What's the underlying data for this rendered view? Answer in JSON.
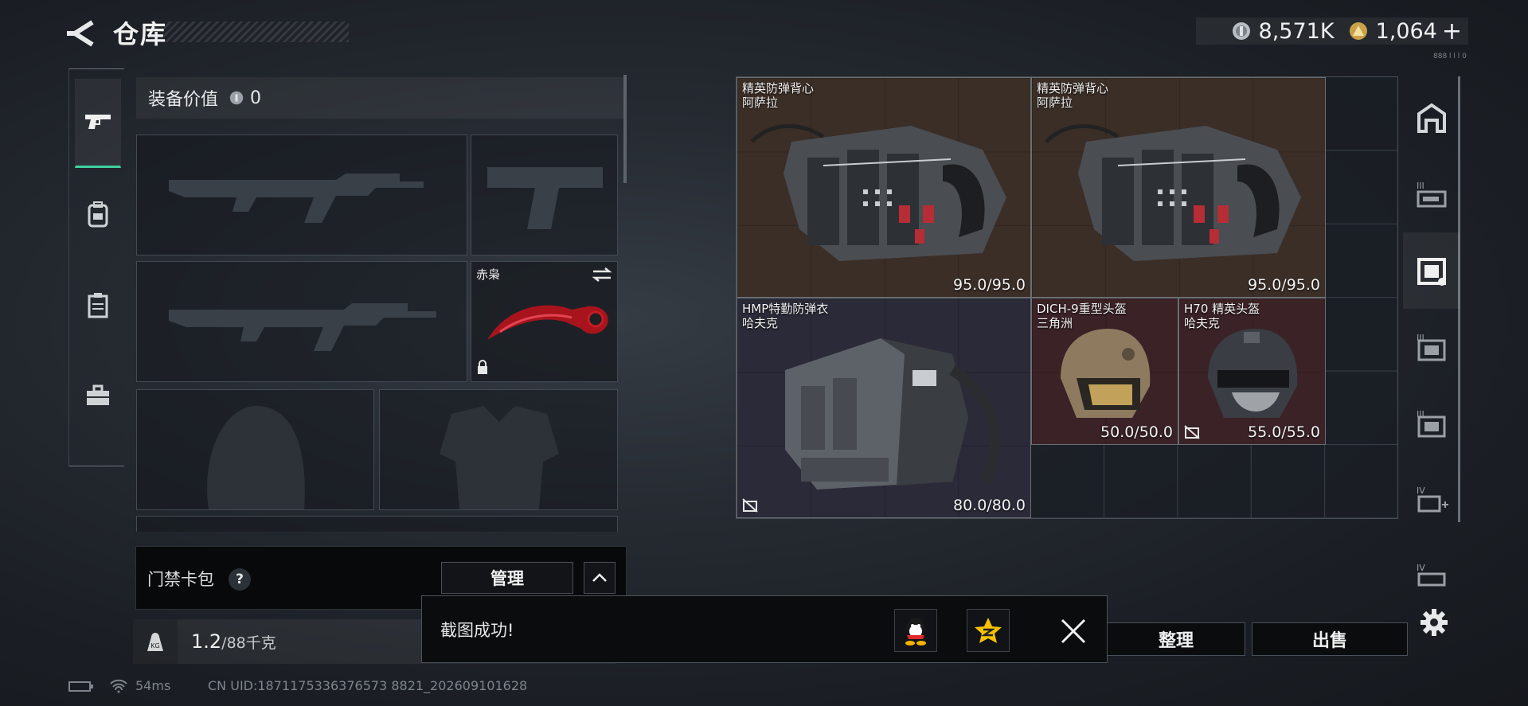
{
  "header": {
    "title": "仓库",
    "currency": [
      {
        "icon": "silver-coin-icon",
        "value": "8,571K"
      },
      {
        "icon": "gold-triangle-icon",
        "value": "1,064"
      }
    ],
    "add_label": "+"
  },
  "left_nav": {
    "items": [
      {
        "name": "weapons",
        "icon": "pistol-icon",
        "selected": true
      },
      {
        "name": "gear",
        "icon": "backpack-icon",
        "selected": false
      },
      {
        "name": "container",
        "icon": "case-icon",
        "selected": false
      },
      {
        "name": "toolbox",
        "icon": "briefcase-icon",
        "selected": false
      }
    ]
  },
  "loadout": {
    "value_label": "装备价值",
    "value_amount": "0",
    "knife_name": "赤枭",
    "card_pack_label": "门禁卡包",
    "help_label": "?",
    "manage_label": "管理",
    "weight_value": "1.2",
    "weight_capacity": "/88千克"
  },
  "stash": {
    "items": [
      {
        "line1": "精英防弹背心",
        "line2": "阿萨拉",
        "durability": "95.0/95.0",
        "kind": "vest"
      },
      {
        "line1": "精英防弹背心",
        "line2": "阿萨拉",
        "durability": "95.0/95.0",
        "kind": "vest"
      },
      {
        "line1": "HMP特勤防弹衣",
        "line2": "哈夫克",
        "durability": "80.0/80.0",
        "kind": "carrier"
      },
      {
        "line1": "DICH-9重型头盔",
        "line2": "三角洲",
        "durability": "50.0/50.0",
        "kind": "helmet-tan"
      },
      {
        "line1": "H70 精英头盔",
        "line2": "哈夫克",
        "durability": "55.0/55.0",
        "kind": "helmet-black"
      }
    ],
    "colors": {
      "brown": "#3b2e27",
      "blue": "#2b2a38",
      "red": "#3a2226"
    }
  },
  "buttons": {
    "sort": "整理",
    "sell": "出售"
  },
  "toast": {
    "message": "截图成功!",
    "share_targets": [
      "qq-icon",
      "qzone-star-icon"
    ]
  },
  "status": {
    "ping": "54ms",
    "uid": "CN UID:1871175336376573 8821_202609101628"
  }
}
